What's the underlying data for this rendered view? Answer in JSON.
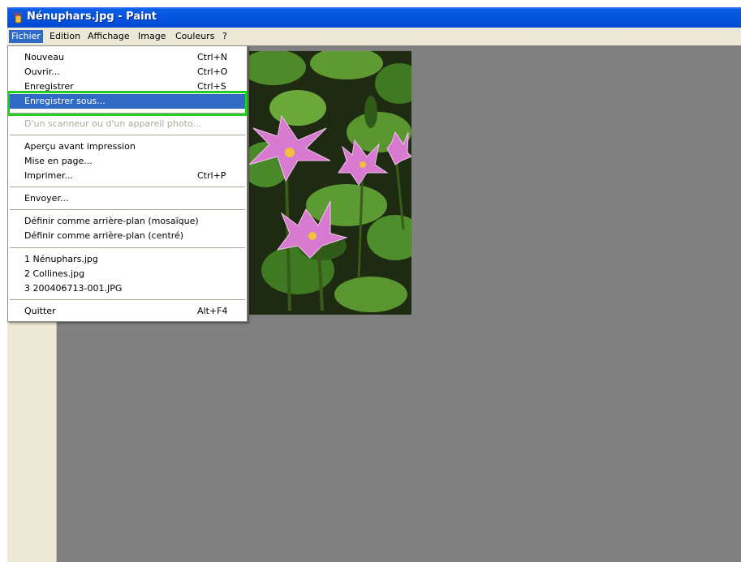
{
  "window": {
    "title": "Nénuphars.jpg - Paint",
    "icon": "paint-bucket-icon"
  },
  "menubar": {
    "items": [
      {
        "label": "Fichier",
        "active": true
      },
      {
        "label": "Edition"
      },
      {
        "label": "Affichage"
      },
      {
        "label": "Image"
      },
      {
        "label": "Couleurs"
      },
      {
        "label": "?"
      }
    ]
  },
  "file_menu": {
    "items": [
      {
        "label": "Nouveau",
        "shortcut": "Ctrl+N"
      },
      {
        "label": "Ouvrir...",
        "shortcut": "Ctrl+O"
      },
      {
        "label": "Enregistrer",
        "shortcut": "Ctrl+S"
      },
      {
        "label": "Enregistrer sous...",
        "highlighted": true
      },
      {
        "label": "D'un scanneur ou d'un appareil photo...",
        "disabled": true
      },
      {
        "label": "Aperçu avant impression"
      },
      {
        "label": "Mise en page..."
      },
      {
        "label": "Imprimer...",
        "shortcut": "Ctrl+P"
      },
      {
        "label": "Envoyer..."
      },
      {
        "label": "Définir comme arrière-plan (mosaïque)"
      },
      {
        "label": "Définir comme arrière-plan (centré)"
      },
      {
        "label": "1 Nénuphars.jpg"
      },
      {
        "label": "2 Collines.jpg"
      },
      {
        "label": "3 200406713-001.JPG"
      },
      {
        "label": "Quitter",
        "shortcut": "Alt+F4"
      }
    ]
  },
  "colors": {
    "title_bar": "#0554e0",
    "menu_highlight": "#316ac5",
    "annotation_box": "#22cc22",
    "workspace": "#808080"
  }
}
